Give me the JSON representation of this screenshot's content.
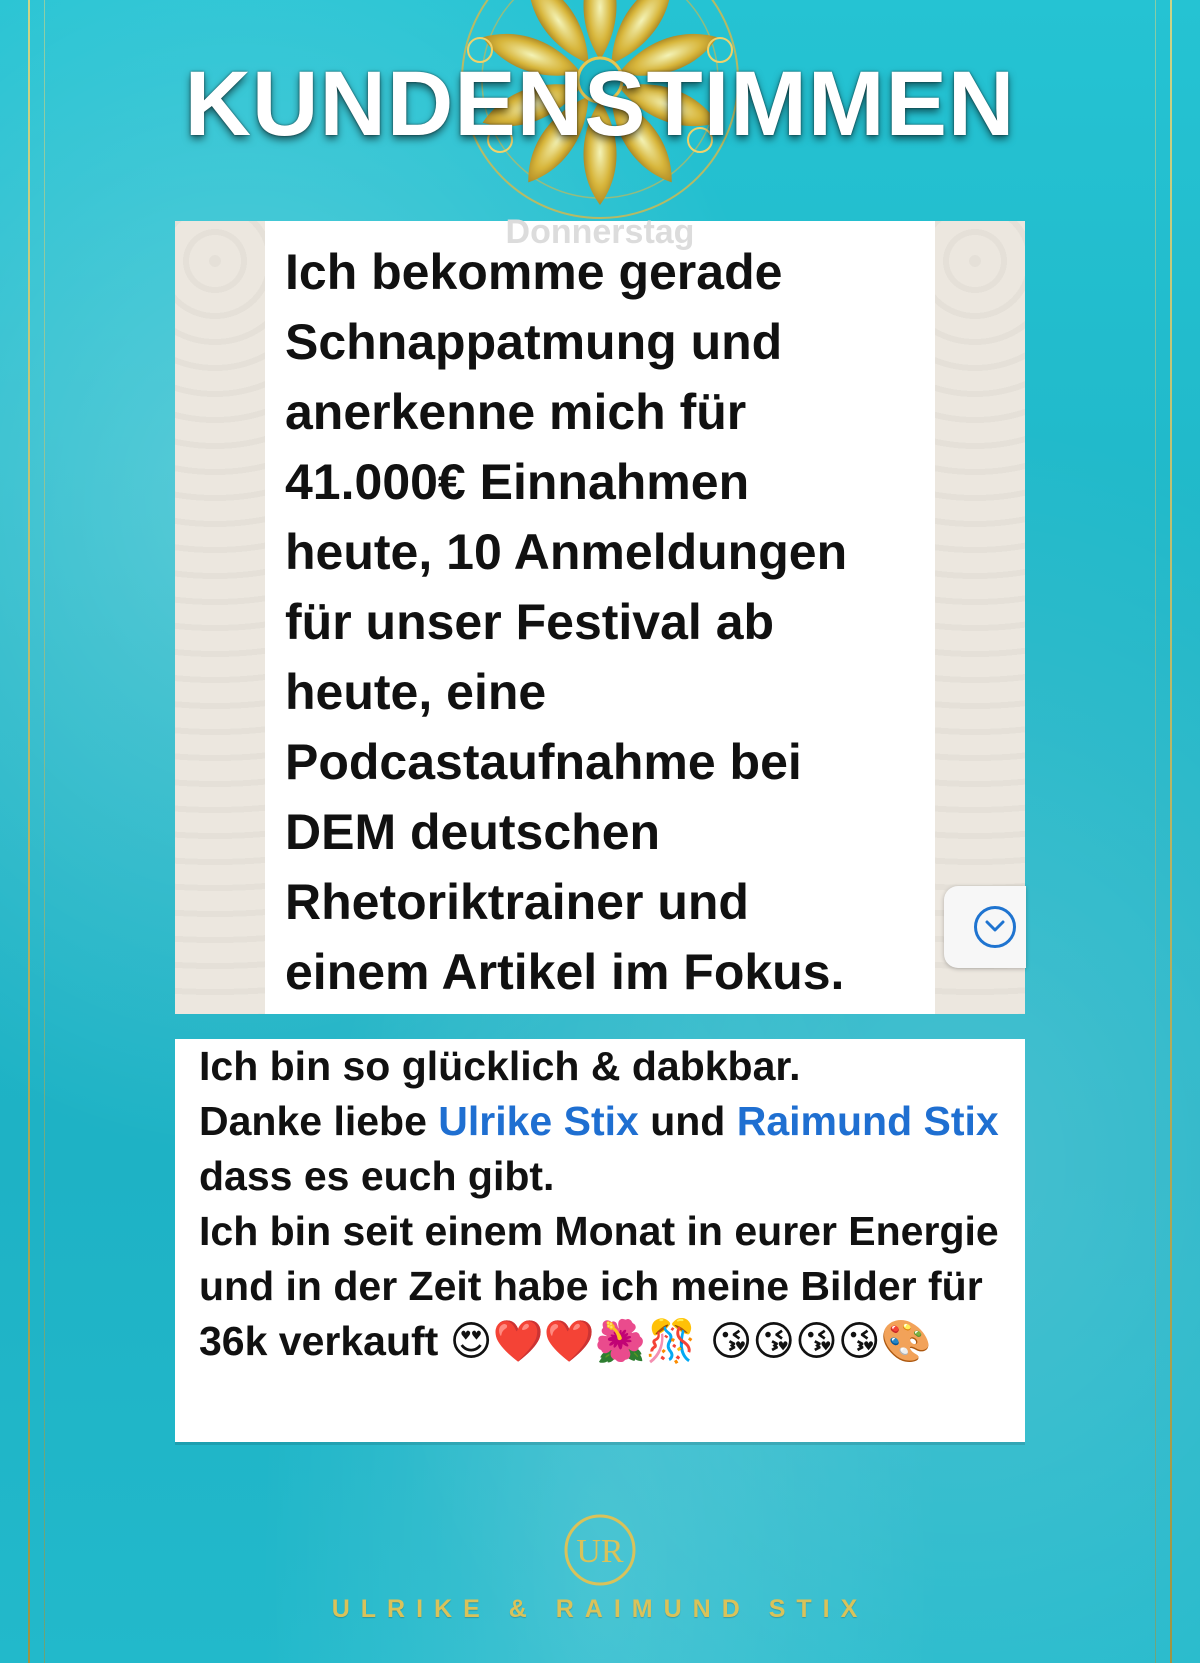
{
  "header": {
    "title": "KUNDENSTIMMEN"
  },
  "testimonial_1": {
    "day_label": "Donnerstag",
    "message": "Ich bekomme gerade\nSchnappatmung und\nanerkenne mich für\n41.000€ Einnahmen\nheute, 10 Anmeldungen\nfür unser Festival ab\nheute, eine\nPodcastaufnahme bei\nDEM deutschen\nRhetoriktrainer und\neinem Artikel im Fokus."
  },
  "testimonial_2": {
    "line1": "Ich bin so glücklich & dabkbar.",
    "thanks_prefix": "Danke liebe ",
    "mention_1": "Ulrike Stix",
    "and_word": " und ",
    "mention_2": "Raimund Stix",
    "thanks_suffix": " dass es euch gibt.",
    "line3": "Ich bin seit einem Monat in eurer Energie und in der Zeit habe ich meine Bilder für 36k verkauft ",
    "emojis": "😍❤️❤️🌺🎊 😘😘😘😘🎨"
  },
  "footer": {
    "logo_text": "UR",
    "brand": "ULRIKE & RAIMUND STIX"
  },
  "colors": {
    "background": "#1fb6c7",
    "gold": "#d9c25a",
    "link_blue": "#1f6fd1"
  }
}
